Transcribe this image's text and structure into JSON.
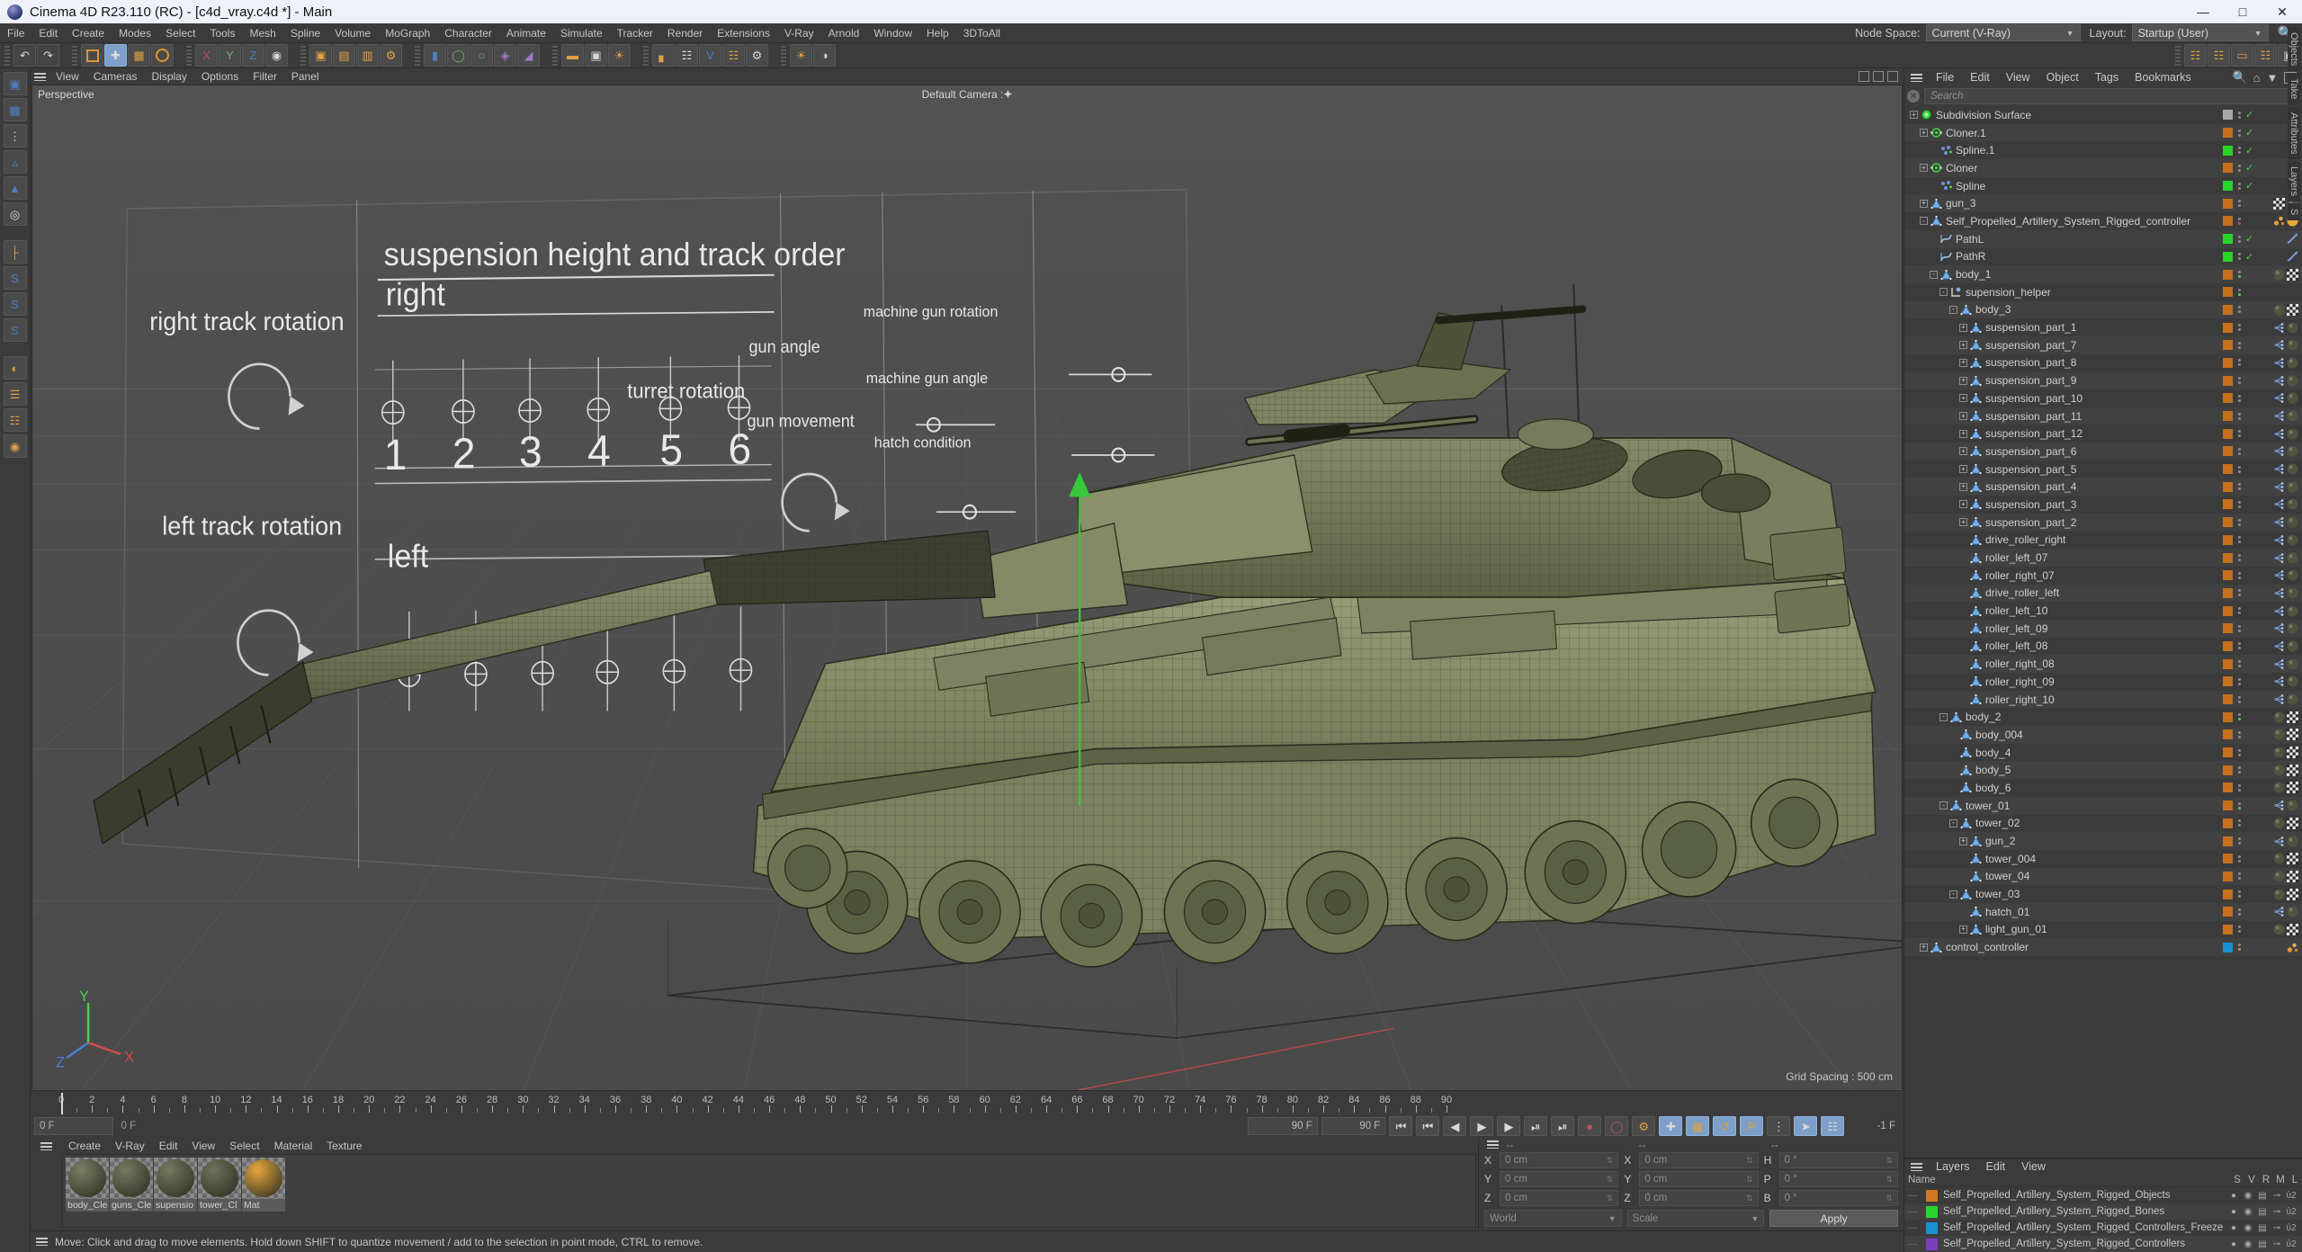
{
  "titlebar": {
    "title": "Cinema 4D R23.110 (RC) - [c4d_vray.c4d *] - Main",
    "minimize": "—",
    "maximize": "□",
    "close": "✕"
  },
  "menubar": {
    "items": [
      "File",
      "Edit",
      "Create",
      "Modes",
      "Select",
      "Tools",
      "Mesh",
      "Spline",
      "Volume",
      "MoGraph",
      "Character",
      "Animate",
      "Simulate",
      "Tracker",
      "Render",
      "Extensions",
      "V-Ray",
      "Arnold",
      "Window",
      "Help",
      "3DToAll"
    ],
    "node_space_label": "Node Space:",
    "node_space_value": "Current (V-Ray)",
    "layout_label": "Layout:",
    "layout_value": "Startup (User)"
  },
  "viewport": {
    "menu": [
      "View",
      "Cameras",
      "Display",
      "Options",
      "Filter",
      "Panel"
    ],
    "label": "Perspective",
    "camera": "Default Camera",
    "grid_spacing": "Grid Spacing : 500 cm",
    "reference_texts": {
      "title": "suspension height and track order",
      "right": "right",
      "left": "left",
      "right_track": "right track rotation",
      "left_track": "left track rotation",
      "numbers": [
        "1",
        "2",
        "3",
        "4",
        "5",
        "6"
      ],
      "turret": "turret rotation",
      "gun_angle": "gun angle",
      "gun_movement": "gun movement",
      "mg_rotation": "machine gun rotation",
      "mg_angle": "machine gun angle",
      "hatch": "hatch condition"
    },
    "axis": {
      "x": "X",
      "y": "Y",
      "z": "Z"
    }
  },
  "timeline": {
    "ticks": [
      0,
      2,
      4,
      6,
      8,
      10,
      12,
      14,
      16,
      18,
      20,
      22,
      24,
      26,
      28,
      30,
      32,
      34,
      36,
      38,
      40,
      42,
      44,
      46,
      48,
      50,
      52,
      54,
      56,
      58,
      60,
      62,
      64,
      66,
      68,
      70,
      72,
      74,
      76,
      78,
      80,
      82,
      84,
      86,
      88,
      90
    ],
    "current_frame": "0 F",
    "frame_field": "0 F",
    "end_frame": "90 F",
    "end_frame_field": "90 F",
    "preview_end": "-1 F"
  },
  "objects": {
    "menu": [
      "File",
      "Edit",
      "View",
      "Object",
      "Tags",
      "Bookmarks"
    ],
    "search_placeholder": "Search",
    "tree": [
      {
        "label": "Subdivision Surface",
        "depth": 0,
        "icon": "subdivision",
        "chip": "#a8a8a8",
        "check": true,
        "exp": "+"
      },
      {
        "label": "Cloner.1",
        "depth": 1,
        "icon": "cloner",
        "chip": "#c4701f",
        "check": true,
        "exp": "+"
      },
      {
        "label": "Spline.1",
        "depth": 2,
        "icon": "spline",
        "chip": "#2ad42a",
        "check": true,
        "tags": [
          "point"
        ]
      },
      {
        "label": "Cloner",
        "depth": 1,
        "icon": "cloner",
        "chip": "#c4701f",
        "check": true,
        "exp": "+"
      },
      {
        "label": "Spline",
        "depth": 2,
        "icon": "spline",
        "chip": "#2ad42a",
        "check": true,
        "tags": [
          "point"
        ]
      },
      {
        "label": "gun_3",
        "depth": 1,
        "icon": "polygon",
        "chip": "#c4701f",
        "exp": "+",
        "tags": [
          "checker",
          "mat"
        ]
      },
      {
        "label": "Self_Propelled_Artillery_System_Rigged_controller",
        "depth": 1,
        "icon": "polygon",
        "chip": "#c4701f",
        "exp": "-",
        "dotred": true,
        "tags": [
          "xpresso",
          "mat-gold"
        ]
      },
      {
        "label": "PathL",
        "depth": 2,
        "icon": "curve",
        "chip": "#2ad42a",
        "check": true,
        "tags": [
          "spline2"
        ]
      },
      {
        "label": "PathR",
        "depth": 2,
        "icon": "curve",
        "chip": "#2ad42a",
        "check": true,
        "tags": [
          "spline2"
        ]
      },
      {
        "label": "body_1",
        "depth": 2,
        "icon": "polygon",
        "chip": "#c4701f",
        "dotgreen": true,
        "exp": "-",
        "tags": [
          "mat",
          "checker"
        ]
      },
      {
        "label": "supension_helper",
        "depth": 3,
        "icon": "helper",
        "chip": "#c4701f",
        "dotgreen": true,
        "exp": "-"
      },
      {
        "label": "body_3",
        "depth": 4,
        "icon": "polygon",
        "chip": "#c4701f",
        "exp": "-",
        "tags": [
          "mat",
          "checker"
        ]
      },
      {
        "label": "suspension_part_1",
        "depth": 5,
        "icon": "polygon",
        "chip": "#c4701f",
        "exp": "+",
        "tags": [
          "point",
          "mat"
        ]
      },
      {
        "label": "suspension_part_7",
        "depth": 5,
        "icon": "polygon",
        "chip": "#c4701f",
        "exp": "+",
        "tags": [
          "point",
          "mat"
        ]
      },
      {
        "label": "suspension_part_8",
        "depth": 5,
        "icon": "polygon",
        "chip": "#c4701f",
        "exp": "+",
        "tags": [
          "point",
          "mat"
        ]
      },
      {
        "label": "suspension_part_9",
        "depth": 5,
        "icon": "polygon",
        "chip": "#c4701f",
        "exp": "+",
        "tags": [
          "point",
          "mat"
        ]
      },
      {
        "label": "suspension_part_10",
        "depth": 5,
        "icon": "polygon",
        "chip": "#c4701f",
        "exp": "+",
        "tags": [
          "point",
          "mat"
        ]
      },
      {
        "label": "suspension_part_11",
        "depth": 5,
        "icon": "polygon",
        "chip": "#c4701f",
        "exp": "+",
        "tags": [
          "point",
          "mat"
        ]
      },
      {
        "label": "suspension_part_12",
        "depth": 5,
        "icon": "polygon",
        "chip": "#c4701f",
        "exp": "+",
        "tags": [
          "point",
          "mat"
        ]
      },
      {
        "label": "suspension_part_6",
        "depth": 5,
        "icon": "polygon",
        "chip": "#c4701f",
        "exp": "+",
        "tags": [
          "point",
          "mat"
        ]
      },
      {
        "label": "suspension_part_5",
        "depth": 5,
        "icon": "polygon",
        "chip": "#c4701f",
        "exp": "+",
        "tags": [
          "point",
          "mat"
        ]
      },
      {
        "label": "suspension_part_4",
        "depth": 5,
        "icon": "polygon",
        "chip": "#c4701f",
        "exp": "+",
        "tags": [
          "point",
          "mat"
        ]
      },
      {
        "label": "suspension_part_3",
        "depth": 5,
        "icon": "polygon",
        "chip": "#c4701f",
        "exp": "+",
        "tags": [
          "point",
          "mat"
        ]
      },
      {
        "label": "suspension_part_2",
        "depth": 5,
        "icon": "polygon",
        "chip": "#c4701f",
        "exp": "+",
        "tags": [
          "point",
          "mat"
        ]
      },
      {
        "label": "drive_roller_right",
        "depth": 5,
        "icon": "polygon",
        "chip": "#c4701f",
        "tags": [
          "point",
          "mat"
        ]
      },
      {
        "label": "roller_left_07",
        "depth": 5,
        "icon": "polygon",
        "chip": "#c4701f",
        "tags": [
          "point",
          "mat"
        ]
      },
      {
        "label": "roller_right_07",
        "depth": 5,
        "icon": "polygon",
        "chip": "#c4701f",
        "tags": [
          "point",
          "mat"
        ]
      },
      {
        "label": "drive_roller_left",
        "depth": 5,
        "icon": "polygon",
        "chip": "#c4701f",
        "tags": [
          "point",
          "mat"
        ]
      },
      {
        "label": "roller_left_10",
        "depth": 5,
        "icon": "polygon",
        "chip": "#c4701f",
        "tags": [
          "point",
          "mat"
        ]
      },
      {
        "label": "roller_left_09",
        "depth": 5,
        "icon": "polygon",
        "chip": "#c4701f",
        "tags": [
          "point",
          "mat"
        ]
      },
      {
        "label": "roller_left_08",
        "depth": 5,
        "icon": "polygon",
        "chip": "#c4701f",
        "tags": [
          "point",
          "mat"
        ]
      },
      {
        "label": "roller_right_08",
        "depth": 5,
        "icon": "polygon",
        "chip": "#c4701f",
        "tags": [
          "point",
          "mat"
        ]
      },
      {
        "label": "roller_right_09",
        "depth": 5,
        "icon": "polygon",
        "chip": "#c4701f",
        "tags": [
          "point",
          "mat"
        ]
      },
      {
        "label": "roller_right_10",
        "depth": 5,
        "icon": "polygon",
        "chip": "#c4701f",
        "tags": [
          "point",
          "mat"
        ]
      },
      {
        "label": "body_2",
        "depth": 3,
        "icon": "polygon",
        "chip": "#c4701f",
        "dotgreen": true,
        "exp": "-",
        "tags": [
          "mat",
          "checker"
        ]
      },
      {
        "label": "body_004",
        "depth": 4,
        "icon": "polygon",
        "chip": "#c4701f",
        "tags": [
          "mat",
          "checker"
        ]
      },
      {
        "label": "body_4",
        "depth": 4,
        "icon": "polygon",
        "chip": "#c4701f",
        "tags": [
          "mat",
          "checker"
        ]
      },
      {
        "label": "body_5",
        "depth": 4,
        "icon": "polygon",
        "chip": "#c4701f",
        "tags": [
          "mat",
          "checker"
        ]
      },
      {
        "label": "body_6",
        "depth": 4,
        "icon": "polygon",
        "chip": "#c4701f",
        "tags": [
          "mat",
          "checker"
        ]
      },
      {
        "label": "tower_01",
        "depth": 3,
        "icon": "polygon",
        "chip": "#c4701f",
        "dotgreen": true,
        "exp": "-",
        "tags": [
          "point",
          "mat"
        ]
      },
      {
        "label": "tower_02",
        "depth": 4,
        "icon": "polygon",
        "chip": "#c4701f",
        "exp": "-",
        "tags": [
          "mat",
          "checker"
        ]
      },
      {
        "label": "gun_2",
        "depth": 5,
        "icon": "polygon",
        "chip": "#c4701f",
        "exp": "+",
        "tags": [
          "point",
          "mat"
        ]
      },
      {
        "label": "tower_004",
        "depth": 5,
        "icon": "polygon",
        "chip": "#c4701f",
        "tags": [
          "mat",
          "checker"
        ]
      },
      {
        "label": "tower_04",
        "depth": 5,
        "icon": "polygon",
        "chip": "#c4701f",
        "tags": [
          "mat",
          "checker"
        ]
      },
      {
        "label": "tower_03",
        "depth": 4,
        "icon": "polygon",
        "chip": "#c4701f",
        "exp": "-",
        "tags": [
          "mat",
          "checker"
        ]
      },
      {
        "label": "hatch_01",
        "depth": 5,
        "icon": "polygon",
        "chip": "#c4701f",
        "tags": [
          "point",
          "mat"
        ]
      },
      {
        "label": "light_gun_01",
        "depth": 5,
        "icon": "polygon",
        "chip": "#c4701f",
        "exp": "+",
        "tags": [
          "mat",
          "checker"
        ]
      },
      {
        "label": "control_controller",
        "depth": 1,
        "icon": "polygon",
        "chip": "#1b90d0",
        "dotorange": true,
        "exp": "+",
        "tags": [
          "xpresso"
        ]
      }
    ]
  },
  "layers": {
    "menu": [
      "Layers",
      "Edit",
      "View"
    ],
    "name_header": "Name",
    "columns": [
      "S",
      "V",
      "R",
      "M",
      "L"
    ],
    "rows": [
      {
        "name": "Self_Propelled_Artillery_System_Rigged_Objects",
        "color": "#d4761f"
      },
      {
        "name": "Self_Propelled_Artillery_System_Rigged_Bones",
        "color": "#2ad42a"
      },
      {
        "name": "Self_Propelled_Artillery_System_Rigged_Controllers_Freeze",
        "color": "#1b90d0"
      },
      {
        "name": "Self_Propelled_Artillery_System_Rigged_Controllers",
        "color": "#7a3fc0"
      }
    ]
  },
  "sidetabs": [
    "Objects",
    "Take",
    "Attributes",
    "Layers",
    "S"
  ],
  "materials": {
    "menu": [
      "Create",
      "V-Ray",
      "Edit",
      "View",
      "Select",
      "Material",
      "Texture"
    ],
    "items": [
      {
        "name": "body_Cle",
        "color": "#7b7f63"
      },
      {
        "name": "guns_Cle",
        "color": "#777b5f"
      },
      {
        "name": "supensio",
        "color": "#757a5e"
      },
      {
        "name": "tower_Cl",
        "color": "#6e7258"
      },
      {
        "name": "Mat",
        "color": "#f0a93a"
      }
    ]
  },
  "coordinates": {
    "header": [
      "--",
      "--",
      "--"
    ],
    "rows": [
      {
        "l1": "X",
        "v1": "0 cm",
        "l2": "X",
        "v2": "0 cm",
        "l3": "H",
        "v3": "0 °"
      },
      {
        "l1": "Y",
        "v1": "0 cm",
        "l2": "Y",
        "v2": "0 cm",
        "l3": "P",
        "v3": "0 °"
      },
      {
        "l1": "Z",
        "v1": "0 cm",
        "l2": "Z",
        "v2": "0 cm",
        "l3": "B",
        "v3": "0 °"
      }
    ],
    "system": "World",
    "mode": "Scale",
    "apply": "Apply"
  },
  "status": {
    "message": "Move: Click and drag to move elements. Hold down SHIFT to quantize movement / add to the selection in point mode, CTRL to remove."
  },
  "colors": {
    "accent_orange": "#e0952e",
    "accent_blue": "#7d9fc9",
    "green": "#2ad42a",
    "panel_bg": "#3b3b3b",
    "viewport_bg": "#4d4d4d"
  }
}
